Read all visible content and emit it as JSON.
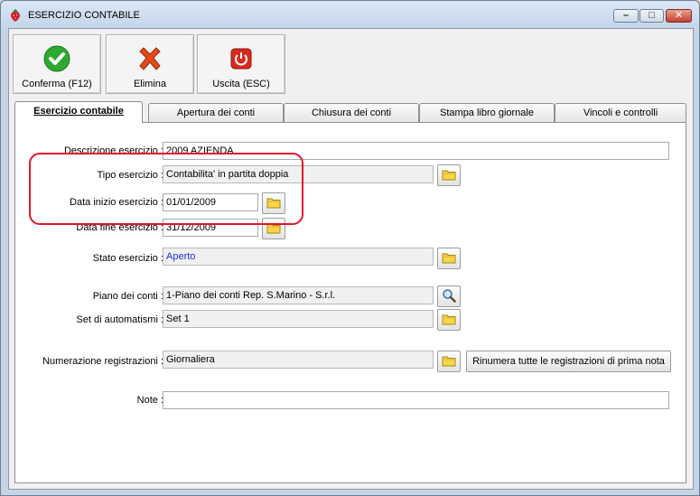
{
  "window": {
    "title": "ESERCIZIO CONTABILE",
    "controls": {
      "minimize": "–",
      "maximize": "□",
      "close": "✕"
    }
  },
  "toolbar": {
    "confirm_label": "Conferma (F12)",
    "delete_label": "Elimina",
    "exit_label": "Uscita (ESC)"
  },
  "tabs": [
    {
      "label": "Esercizio contabile",
      "active": true
    },
    {
      "label": "Apertura dei conti",
      "active": false
    },
    {
      "label": "Chiusura dei conti",
      "active": false
    },
    {
      "label": "Stampa libro giornale",
      "active": false
    },
    {
      "label": "Vincoli e controlli",
      "active": false
    }
  ],
  "form": {
    "descrizione": {
      "label": "Descrizione esercizio :",
      "value": "2009 AZIENDA"
    },
    "tipo": {
      "label": "Tipo esercizio :",
      "value": "Contabilita' in partita doppia"
    },
    "data_inizio": {
      "label": "Data inizio esercizio :",
      "value": "01/01/2009"
    },
    "data_fine": {
      "label": "Data fine esercizio :",
      "value": "31/12/2009"
    },
    "stato": {
      "label": "Stato esercizio :",
      "value": "Aperto"
    },
    "piano": {
      "label": "Piano dei conti :",
      "value": "1-Piano dei conti Rep. S.Marino - S.r.l."
    },
    "automatismi": {
      "label": "Set di automatismi :",
      "value": "Set 1"
    },
    "numerazione": {
      "label": "Numerazione registrazioni :",
      "value": "Giornaliera"
    },
    "rinumera_label": "Rinumera tutte le registrazioni di prima nota",
    "note": {
      "label": "Note :",
      "value": ""
    }
  },
  "colors": {
    "highlight": "#e0162b",
    "confirm_icon": "#2fa82f",
    "delete_icon": "#e04a1a",
    "exit_icon": "#d9291f",
    "stato_text": "#1d2fd6"
  }
}
